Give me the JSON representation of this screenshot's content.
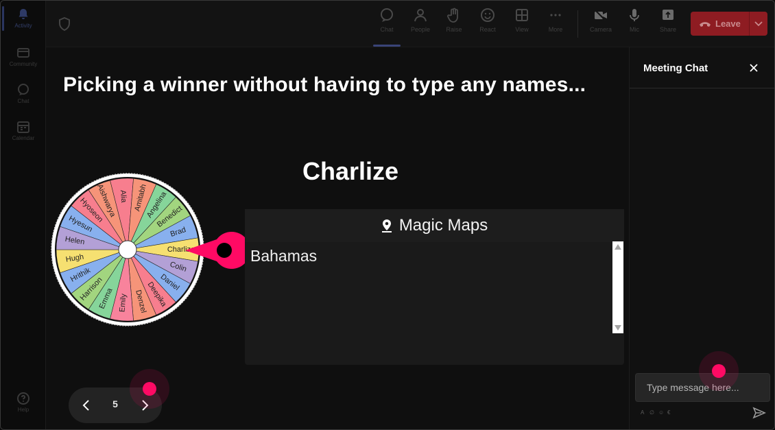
{
  "rail": {
    "items": [
      {
        "label": "Activity",
        "icon": "bell-icon",
        "active": true
      },
      {
        "label": "Community",
        "icon": "community-icon"
      },
      {
        "label": "Chat",
        "icon": "chat-icon"
      },
      {
        "label": "Calendar",
        "icon": "calendar-icon"
      },
      {
        "label": "Help",
        "icon": "help-icon"
      }
    ]
  },
  "toolbar": {
    "chat": "Chat",
    "people": "People",
    "raise": "Raise",
    "react": "React",
    "view": "View",
    "more": "More",
    "camera": "Camera",
    "mic": "Mic",
    "share": "Share",
    "leave": "Leave"
  },
  "stage": {
    "title": "Picking a winner without having to type any names...",
    "winner": "Charlize",
    "wheel": {
      "names": [
        "Alia",
        "Amitabh",
        "Angelina",
        "Benedict",
        "Brad",
        "Charlize",
        "Colin",
        "Daniel",
        "Deepika",
        "Denzel",
        "Emily",
        "Emma",
        "Harrison",
        "Hrithik",
        "Hugh",
        "Helen",
        "Hyesun",
        "Hyoseon",
        "Aishwarya"
      ],
      "colors": [
        "#f77e8e",
        "#f69479",
        "#86d59a",
        "#a2d57f",
        "#88b0ee",
        "#f6e071",
        "#b3a0d6",
        "#88b0ee",
        "#f77e8e",
        "#f69479",
        "#f8839c",
        "#86d59a",
        "#a2d57f",
        "#88b0ee",
        "#f6e071",
        "#b3a0d6",
        "#88b0ee",
        "#f77e8e",
        "#f69479"
      ],
      "pointer_color": "#ff0a64"
    },
    "map_panel": {
      "title": "Magic Maps",
      "icon": "map-pin-icon",
      "content": "Bahamas"
    },
    "pager": {
      "page": "5"
    }
  },
  "chat": {
    "title": "Meeting Chat",
    "input_placeholder": "Type message here..."
  }
}
